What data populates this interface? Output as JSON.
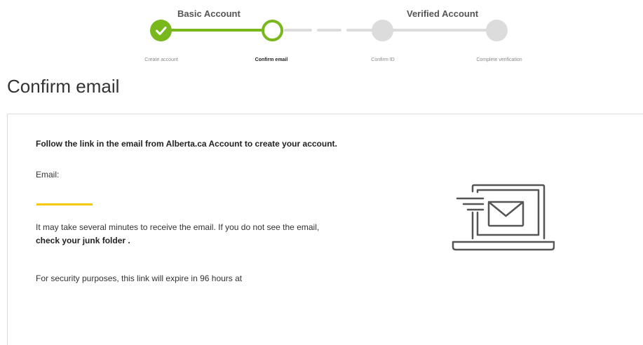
{
  "progress": {
    "groups": {
      "basic": "Basic Account",
      "verified": "Verified Account"
    },
    "steps": [
      {
        "label": "Create account",
        "state": "done"
      },
      {
        "label": "Confirm email",
        "state": "active"
      },
      {
        "label": "Confirm ID",
        "state": "pending"
      },
      {
        "label": "Complete verification",
        "state": "pending"
      }
    ]
  },
  "page": {
    "title": "Confirm email"
  },
  "panel": {
    "instruction": "Follow the link in the email from Alberta.ca Account to create your account.",
    "email_label": "Email:",
    "delay_text": "It may take several minutes to receive the email. If you do not see the email,",
    "junk_folder_text": "check your junk folder",
    "junk_folder_suffix": " .",
    "expiry_text": "For security purposes, this link will expire in 96 hours at"
  },
  "colors": {
    "accent_green": "#78b81c",
    "pending_gray": "#dcdcdc",
    "highlight_yellow": "#f5c800"
  },
  "icons": {
    "completed_step": "check-icon",
    "illustration": "laptop-email-icon"
  }
}
